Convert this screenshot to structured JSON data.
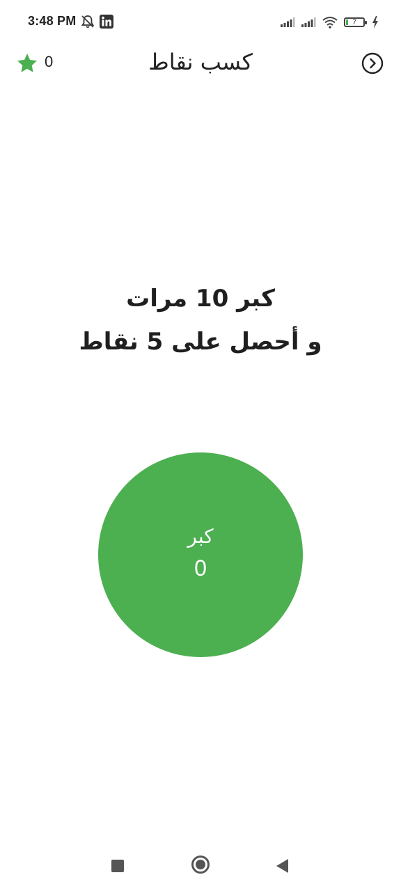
{
  "status_bar": {
    "time": "3:48 PM",
    "battery_level": "7",
    "icons": [
      "muted-bell-icon",
      "linkedin-icon",
      "cell-signal-icon",
      "cell-signal-icon",
      "wifi-icon",
      "battery-icon",
      "charging-bolt-icon"
    ]
  },
  "app_bar": {
    "title": "كسب نقاط",
    "points": "0",
    "star_icon": "star-icon",
    "back_icon": "circle-chevron-right-icon"
  },
  "instruction": {
    "line1": "كبر 10 مرات",
    "line2": "و أحصل على 5 نقاط"
  },
  "counter": {
    "label": "كبر",
    "value": "0"
  },
  "colors": {
    "accent": "#4caf50",
    "text": "#1f1f1f",
    "background": "#ffffff"
  },
  "nav_bar": {
    "buttons": [
      "recents-button",
      "home-button",
      "back-button"
    ]
  }
}
